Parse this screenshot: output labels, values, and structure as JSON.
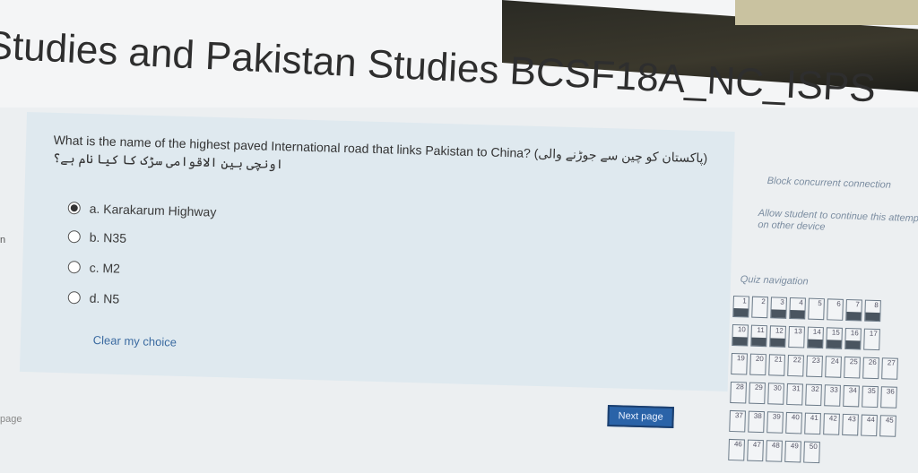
{
  "header": {
    "title": "Studies and Pakistan Studies BCSF18A_NC_ISPS"
  },
  "question": {
    "text": "What is the name of the highest paved International road that links Pakistan to China? (پاکستان کو چین سے جوڑنے والی) اونچی بین الاقوامی سڑک کا کیا نام ہے؟",
    "options": [
      {
        "label": "a. Karakarum Highway",
        "selected": true
      },
      {
        "label": "b. N35",
        "selected": false
      },
      {
        "label": "c. M2",
        "selected": false
      },
      {
        "label": "d. N5",
        "selected": false
      }
    ],
    "clear_label": "Clear my choice"
  },
  "sidebar": {
    "block_text": "Block concurrent connection",
    "allow_text": "Allow student to continue this attempt on other device",
    "quiz_nav_title": "Quiz navigation",
    "rows": [
      [
        "1",
        "2",
        "3",
        "4",
        "5",
        "6",
        "7",
        "8"
      ],
      [
        "10",
        "11",
        "12",
        "13",
        "14",
        "15",
        "16",
        "17"
      ],
      [
        "19",
        "20",
        "21",
        "22",
        "23",
        "24",
        "25",
        "26",
        "27"
      ],
      [
        "28",
        "29",
        "30",
        "31",
        "32",
        "33",
        "34",
        "35",
        "36"
      ],
      [
        "37",
        "38",
        "39",
        "40",
        "41",
        "42",
        "43",
        "44",
        "45"
      ],
      [
        "46",
        "47",
        "48",
        "49",
        "50"
      ]
    ]
  },
  "footer": {
    "prev_label": "page",
    "next_label": "Next page"
  },
  "left_mark": "n"
}
